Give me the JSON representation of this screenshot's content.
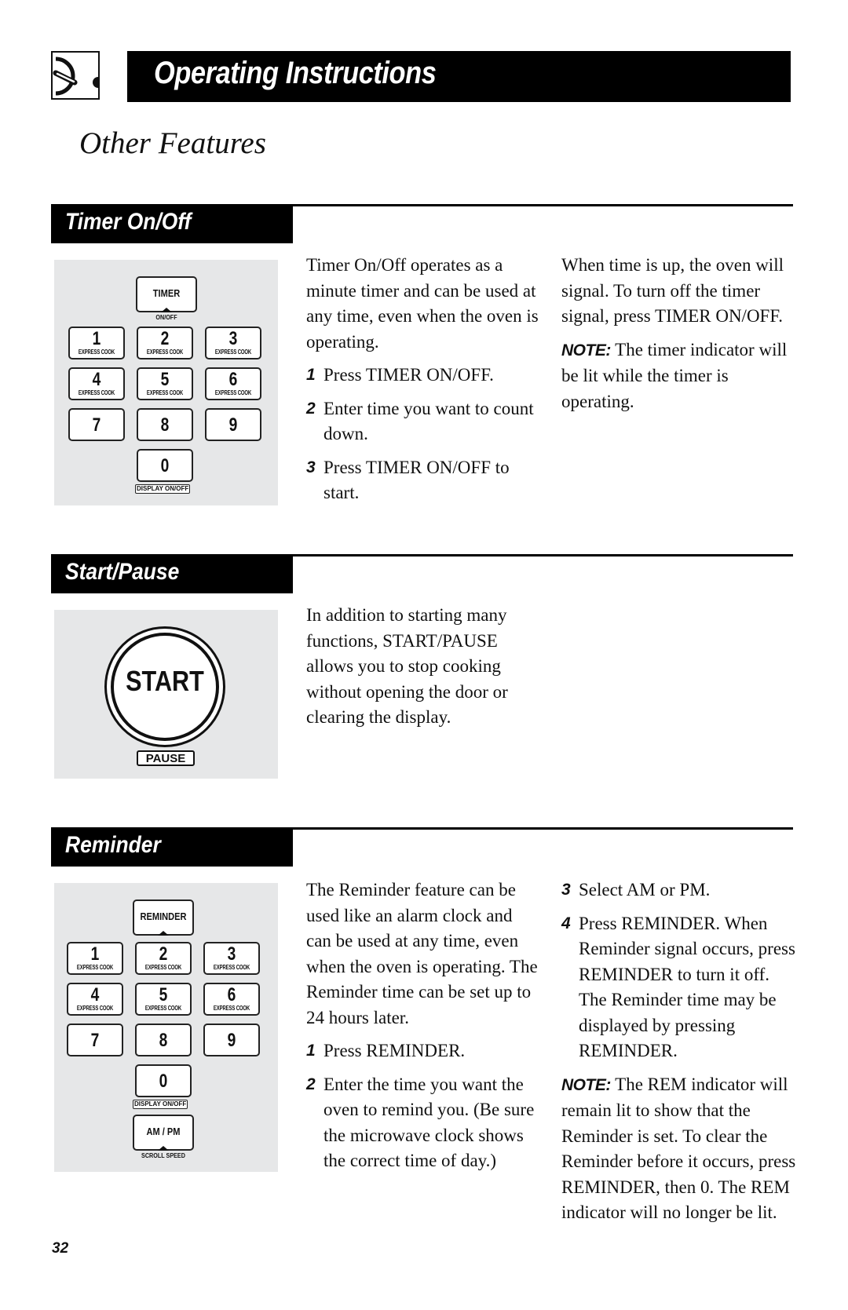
{
  "header": {
    "icon": "oven-dial-icon",
    "title": "Operating Instructions"
  },
  "page_subtitle": "Other Features",
  "sections": {
    "timer": {
      "title": "Timer On/Off",
      "keypad": {
        "function_key": "TIMER",
        "function_caption": "ON/OFF",
        "keys": [
          {
            "num": "1",
            "sub": "EXPRESS COOK"
          },
          {
            "num": "2",
            "sub": "EXPRESS COOK"
          },
          {
            "num": "3",
            "sub": "EXPRESS COOK"
          },
          {
            "num": "4",
            "sub": "EXPRESS COOK"
          },
          {
            "num": "5",
            "sub": "EXPRESS COOK"
          },
          {
            "num": "6",
            "sub": "EXPRESS COOK"
          },
          {
            "num": "7",
            "sub": ""
          },
          {
            "num": "8",
            "sub": ""
          },
          {
            "num": "9",
            "sub": ""
          },
          {
            "num": "0",
            "sub": ""
          }
        ],
        "zero_caption": "DISPLAY ON/OFF"
      },
      "intro": "Timer On/Off operates as a minute timer and can be used at any time, even when the oven is operating.",
      "steps": [
        {
          "num": "1",
          "text": "Press TIMER ON/OFF."
        },
        {
          "num": "2",
          "text": "Enter time you want to count down."
        },
        {
          "num": "3",
          "text": "Press TIMER ON/OFF to start."
        }
      ],
      "right_text": "When time is up, the oven will signal. To turn off the timer signal, press TIMER ON/OFF.",
      "note_label": "NOTE:",
      "note_text": " The timer indicator will be lit while the timer is operating."
    },
    "start_pause": {
      "title": "Start/Pause",
      "button_label": "START",
      "button_caption": "PAUSE",
      "text": "In addition to starting many functions, START/PAUSE allows you to stop cooking without opening the door or clearing the display."
    },
    "reminder": {
      "title": "Reminder",
      "keypad": {
        "function_key": "REMINDER",
        "keys": [
          {
            "num": "1",
            "sub": "EXPRESS COOK"
          },
          {
            "num": "2",
            "sub": "EXPRESS COOK"
          },
          {
            "num": "3",
            "sub": "EXPRESS COOK"
          },
          {
            "num": "4",
            "sub": "EXPRESS COOK"
          },
          {
            "num": "5",
            "sub": "EXPRESS COOK"
          },
          {
            "num": "6",
            "sub": "EXPRESS COOK"
          },
          {
            "num": "7",
            "sub": ""
          },
          {
            "num": "8",
            "sub": ""
          },
          {
            "num": "9",
            "sub": ""
          },
          {
            "num": "0",
            "sub": ""
          }
        ],
        "zero_caption": "DISPLAY ON/OFF",
        "ampm_key": "AM / PM",
        "ampm_caption": "SCROLL SPEED"
      },
      "intro": "The Reminder feature can be used like an alarm clock and can be used at any time, even when the oven is operating. The Reminder time can be set up to 24 hours later.",
      "steps_left": [
        {
          "num": "1",
          "text": "Press REMINDER."
        },
        {
          "num": "2",
          "text": "Enter the time you want the oven to remind you. (Be sure the microwave clock shows the correct time of day.)"
        }
      ],
      "steps_right": [
        {
          "num": "3",
          "text": "Select AM or PM."
        },
        {
          "num": "4",
          "text": "Press REMINDER. When Reminder signal occurs, press REMINDER to turn it off. The Reminder time may be displayed by pressing REMINDER."
        }
      ],
      "note_label": "NOTE:",
      "note_text": " The REM indicator will remain lit to show that the Reminder is set. To clear the Reminder before it occurs, press REMINDER, then 0. The REM indicator will no longer be lit."
    }
  },
  "page_number": "32"
}
